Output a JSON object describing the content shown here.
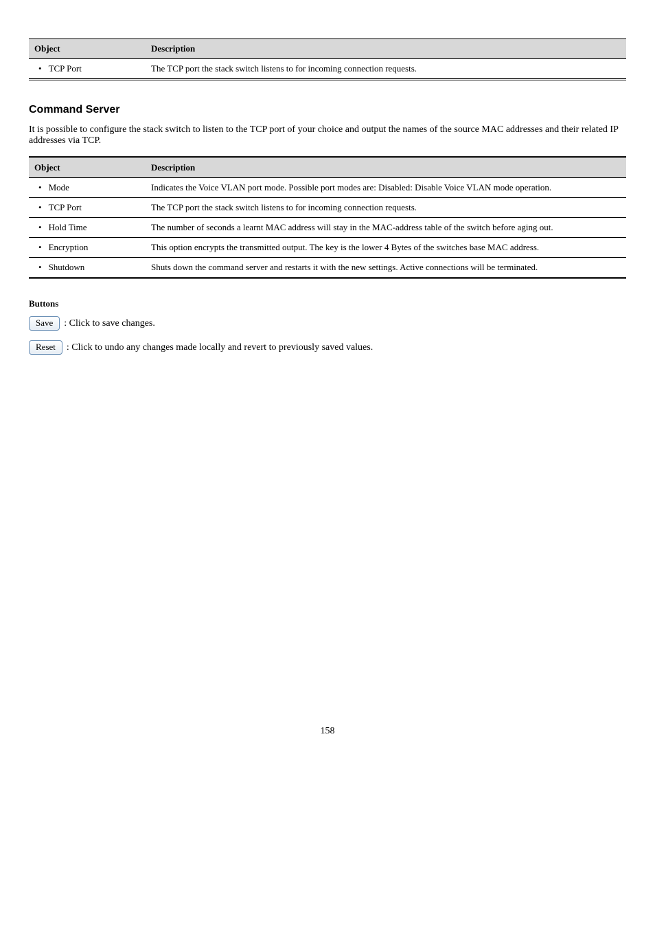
{
  "table1": {
    "headers": [
      "Object",
      "Description"
    ],
    "rows": [
      {
        "obj": "TCP Port",
        "desc": "The TCP port the stack switch listens to for incoming connection requests."
      }
    ]
  },
  "section_title": "Command Server",
  "section_para": "It is possible to configure the stack switch to listen to the TCP port of your choice and output the names of the source MAC addresses and their related IP addresses via TCP.",
  "table2": {
    "headers": [
      "Object",
      "Description"
    ],
    "rows": [
      {
        "obj": "Mode",
        "desc": "Indicates the Voice VLAN port mode. Possible port modes are: Disabled: Disable Voice VLAN mode operation."
      },
      {
        "obj": "TCP Port",
        "desc": "The TCP port the stack switch listens to for incoming connection requests."
      },
      {
        "obj": "Hold Time",
        "desc": "The number of seconds a learnt MAC address will stay in the MAC-address table of the switch before aging out."
      },
      {
        "obj": "Encryption",
        "desc": "This option encrypts the transmitted output. The key is the lower 4 Bytes of the switches base MAC address."
      },
      {
        "obj": "Shutdown",
        "desc": "Shuts down the command server and restarts it with the new settings. Active connections will be terminated."
      }
    ]
  },
  "buttons": {
    "heading": "Buttons",
    "save": {
      "label": "Save",
      "desc": ": Click to save changes."
    },
    "reset": {
      "label": "Reset",
      "desc": ": Click to undo any changes made locally and revert to previously saved values."
    }
  },
  "page_number": "158"
}
